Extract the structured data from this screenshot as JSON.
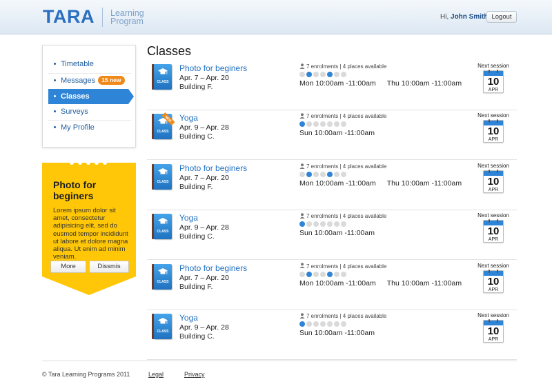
{
  "header": {
    "logo": "TARA",
    "logo_sub_line1": "Learning",
    "logo_sub_line2": "Program",
    "greeting_prefix": "Hi,",
    "user_name": "John Smith",
    "logout_label": "Logout"
  },
  "nav": {
    "items": [
      {
        "label": "Timetable"
      },
      {
        "label": "Messages",
        "badge": "15 new"
      },
      {
        "label": "Classes"
      },
      {
        "label": "Surveys"
      },
      {
        "label": "My Profile"
      }
    ],
    "active_index": 2
  },
  "promo": {
    "title": "Photo for beginers",
    "text": "Lorem ipsum dolor sit amet, consectetur adipisicing elit, sed do eusmod tempor incididunt ut labore et dolore magna aliqua. Ut enim ad minim veniam.",
    "more_label": "More",
    "dismiss_label": "Dissmis"
  },
  "main": {
    "title": "Classes",
    "classes": [
      {
        "title": "Photo for beginers",
        "dates": "Apr. 7 –  Apr. 20",
        "building": "Building F.",
        "enrolments": "7 enrolments",
        "places": "4 places available",
        "sessions": [
          "Mon 10:00am -11:00am",
          "Thu 10:00am -11:00am"
        ],
        "next_label": "Next session",
        "day": "10",
        "month": "APR",
        "book_label": "CLASS",
        "is_new": false
      },
      {
        "title": "Yoga",
        "dates": "Apr. 9 –  Apr. 28",
        "building": "Building C.",
        "enrolments": "7 enrolments",
        "places": "4 places available",
        "sessions": [
          "Sun 10:00am -11:00am"
        ],
        "next_label": "Next session",
        "day": "10",
        "month": "APR",
        "book_label": "CLASS",
        "is_new": true,
        "new_label": "NEW"
      },
      {
        "title": "Photo for beginers",
        "dates": "Apr. 7 –  Apr. 20",
        "building": "Building F.",
        "enrolments": "7 enrolments",
        "places": "4 places available",
        "sessions": [
          "Mon 10:00am -11:00am",
          "Thu 10:00am -11:00am"
        ],
        "next_label": "Next session",
        "day": "10",
        "month": "APR",
        "book_label": "CLASS",
        "is_new": false
      },
      {
        "title": "Yoga",
        "dates": "Apr. 9 –  Apr. 28",
        "building": "Building C.",
        "enrolments": "7 enrolments",
        "places": "4 places available",
        "sessions": [
          "Sun 10:00am -11:00am"
        ],
        "next_label": "Next session",
        "day": "10",
        "month": "APR",
        "book_label": "CLASS",
        "is_new": false
      },
      {
        "title": "Photo for beginers",
        "dates": "Apr. 7 –  Apr. 20",
        "building": "Building F.",
        "enrolments": "7 enrolments",
        "places": "4 places available",
        "sessions": [
          "Mon 10:00am -11:00am",
          "Thu 10:00am -11:00am"
        ],
        "next_label": "Next session",
        "day": "10",
        "month": "APR",
        "book_label": "CLASS",
        "is_new": false
      },
      {
        "title": "Yoga",
        "dates": "Apr. 9 –  Apr. 28",
        "building": "Building C.",
        "enrolments": "7 enrolments",
        "places": "4 places available",
        "sessions": [
          "Sun 10:00am -11:00am"
        ],
        "next_label": "Next session",
        "day": "10",
        "month": "APR",
        "book_label": "CLASS",
        "is_new": false
      }
    ],
    "session_dots": [
      [
        false,
        true,
        false,
        false,
        true,
        false,
        false
      ],
      [
        true,
        false,
        false,
        false,
        false,
        false,
        false
      ],
      [
        false,
        true,
        false,
        false,
        true,
        false,
        false
      ],
      [
        true,
        false,
        false,
        false,
        false,
        false,
        false
      ],
      [
        false,
        true,
        false,
        false,
        true,
        false,
        false
      ],
      [
        true,
        false,
        false,
        false,
        false,
        false,
        false
      ]
    ]
  },
  "footer": {
    "copyright": "© Tara Learning Programs 2011",
    "legal": "Legal",
    "privacy": "Privacy"
  },
  "colors": {
    "brand_blue": "#2e84d6",
    "link_blue": "#2272c3",
    "promo_yellow": "#ffc708",
    "badge_orange": "#f0891c"
  }
}
